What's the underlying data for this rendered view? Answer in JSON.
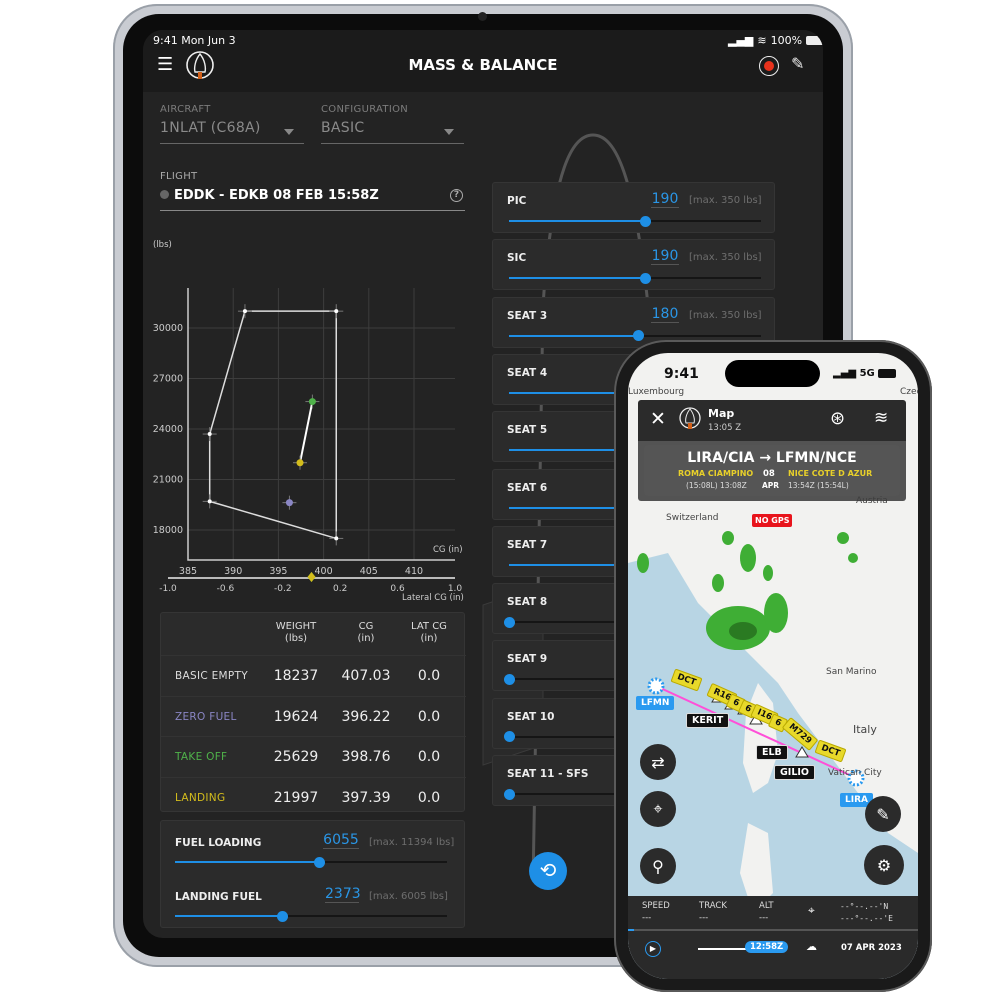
{
  "ipad": {
    "status": {
      "time": "9:41",
      "date": "Mon Jun 3",
      "battery": "100%"
    },
    "header": {
      "title": "MASS & BALANCE",
      "menu_icon": "hamburger-icon",
      "logo_icon": "app-logo-icon",
      "record_icon": "record-icon",
      "edit_icon": "pencil-icon"
    },
    "aircraft": {
      "label": "AIRCRAFT",
      "value": "1NLAT (C68A)"
    },
    "configuration": {
      "label": "CONFIGURATION",
      "value": "BASIC"
    },
    "flight": {
      "label": "FLIGHT",
      "value": "EDDK - EDKB  08 FEB 15:58Z",
      "help": "?"
    },
    "seats": [
      {
        "name": "PIC",
        "value": "190",
        "max": "[max. 350 lbs]",
        "fraction": 0.543
      },
      {
        "name": "SIC",
        "value": "190",
        "max": "[max. 350 lbs]",
        "fraction": 0.543
      },
      {
        "name": "SEAT 3",
        "value": "180",
        "max": "[max. 350 lbs]",
        "fraction": 0.514
      },
      {
        "name": "SEAT 4",
        "fraction": 0.5
      },
      {
        "name": "SEAT 5",
        "fraction": 0.5
      },
      {
        "name": "SEAT 6",
        "fraction": 0.5
      },
      {
        "name": "SEAT 7",
        "fraction": 0.5
      },
      {
        "name": "SEAT 8",
        "fraction": 0
      },
      {
        "name": "SEAT 9",
        "fraction": 0
      },
      {
        "name": "SEAT 10",
        "fraction": 0
      },
      {
        "name": "SEAT 11 - SFS",
        "fraction": 0
      }
    ],
    "table": {
      "headers": [
        {
          "l1": "WEIGHT",
          "l2": "(lbs)"
        },
        {
          "l1": "CG",
          "l2": "(in)"
        },
        {
          "l1": "LAT CG",
          "l2": "(in)"
        }
      ],
      "rows": [
        {
          "label": "BASIC EMPTY",
          "color": "#dddddd",
          "weight": "18237",
          "cg": "407.03",
          "lat": "0.0"
        },
        {
          "label": "ZERO FUEL",
          "color": "#8a86c4",
          "weight": "19624",
          "cg": "396.22",
          "lat": "0.0"
        },
        {
          "label": "TAKE OFF",
          "color": "#4fb24a",
          "weight": "25629",
          "cg": "398.76",
          "lat": "0.0"
        },
        {
          "label": "LANDING",
          "color": "#d4bd1c",
          "weight": "21997",
          "cg": "397.39",
          "lat": "0.0"
        }
      ]
    },
    "fuel": {
      "loading": {
        "label": "FUEL LOADING",
        "value": "6055",
        "max": "[max. 11394 lbs]",
        "fraction": 0.531
      },
      "landing": {
        "label": "LANDING FUEL",
        "value": "2373",
        "max": "[max. 6005 lbs]",
        "fraction": 0.395
      }
    },
    "reset_icon": "rotate-ccw-icon"
  },
  "chart_data": [
    {
      "type": "scatter",
      "ylabel": "(lbs)",
      "xlabel": "CG (in)",
      "xlim": [
        382.5,
        412
      ],
      "ylim": [
        16000,
        32500
      ],
      "xticks": [
        "385",
        "390",
        "395",
        "400",
        "405",
        "410"
      ],
      "yticks": [
        "30000",
        "27000",
        "24000",
        "21000",
        "18000"
      ],
      "grid": true,
      "envelope": [
        [
          391.3,
          31000
        ],
        [
          401.4,
          31000
        ],
        [
          401.4,
          17500
        ],
        [
          387.4,
          19700
        ],
        [
          387.4,
          23700
        ]
      ],
      "points": [
        {
          "label": "ZERO FUEL",
          "cg": 396.22,
          "weight": 19624,
          "color": "#8a86c4"
        },
        {
          "label": "TAKE OFF",
          "cg": 398.76,
          "weight": 25629,
          "color": "#4fb24a"
        },
        {
          "label": "LANDING",
          "cg": 397.39,
          "weight": 21997,
          "color": "#d4bd1c"
        }
      ]
    },
    {
      "type": "scatter",
      "xlabel": "Lateral CG (in)",
      "xlim": [
        -1.0,
        1.0
      ],
      "xticks": [
        "-1.0",
        "-0.6",
        "-0.2",
        "0.2",
        "0.6",
        "1.0"
      ],
      "points": [
        {
          "label": "TAKE OFF",
          "lat": 0.0,
          "color": "#4fb24a"
        },
        {
          "label": "LANDING",
          "lat": 0.0,
          "color": "#d4bd1c"
        }
      ]
    }
  ],
  "phone": {
    "status": {
      "time": "9:41",
      "network": "5G"
    },
    "header": {
      "title": "Map",
      "time": "13:05 Z"
    },
    "route": {
      "from_code": "LIRA/CIA",
      "to_code": "LFMN/NCE",
      "from_name": "ROMA CIAMPINO",
      "to_name": "NICE COTE D AZUR",
      "day": "08",
      "month": "APR",
      "from_time": "(15:08L) 13:08Z",
      "to_time": "13:54Z (15:54L)"
    },
    "no_gps": "NO GPS",
    "map_labels": [
      "Luxembourg",
      "Czech",
      "Austria",
      "Switzerland",
      "San Marino",
      "Italy",
      "Vatican City"
    ],
    "airports": [
      "LFMN",
      "LIRA"
    ],
    "waypoints": [
      "KERIT",
      "ELB",
      "GILIO"
    ],
    "airways": [
      "DCT",
      "R16",
      "6",
      "6",
      "I16",
      "6",
      "M729",
      "DCT"
    ],
    "bottom": {
      "speed_label": "SPEED",
      "speed": "---",
      "track_label": "TRACK",
      "track": "---",
      "alt_label": "ALT",
      "alt": "---",
      "lat": "--°--.--'N",
      "lon": "---°--.--'E",
      "time": "12:58Z",
      "date": "07 APR 2023"
    },
    "colors": {
      "accent": "#2a9af0",
      "route": "#ff4fd8",
      "no_gps": "#e8141c"
    }
  }
}
